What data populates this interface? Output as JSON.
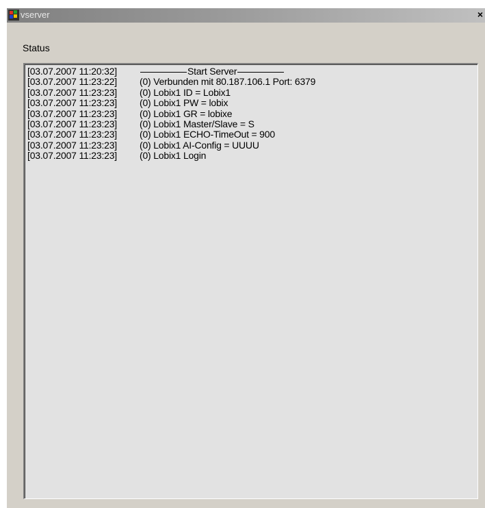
{
  "window": {
    "title": "vserver",
    "close_glyph": "×"
  },
  "status": {
    "label": "Status"
  },
  "log": {
    "start_text": "Start Server",
    "entries": [
      {
        "time": "[03.07.2007 11:20:32]",
        "message": ""
      },
      {
        "time": "[03.07.2007 11:23:22]",
        "message": "(0) Verbunden mit 80.187.106.1 Port: 6379"
      },
      {
        "time": "[03.07.2007 11:23:23]",
        "message": "(0) Lobix1 ID = Lobix1"
      },
      {
        "time": "[03.07.2007 11:23:23]",
        "message": "(0) Lobix1 PW = lobix"
      },
      {
        "time": "[03.07.2007 11:23:23]",
        "message": "(0) Lobix1 GR = lobixe"
      },
      {
        "time": "[03.07.2007 11:23:23]",
        "message": "(0) Lobix1 Master/Slave = S"
      },
      {
        "time": "[03.07.2007 11:23:23]",
        "message": "(0) Lobix1 ECHO-TimeOut = 900"
      },
      {
        "time": "[03.07.2007 11:23:23]",
        "message": "(0) Lobix1 AI-Config = UUUU"
      },
      {
        "time": "[03.07.2007 11:23:23]",
        "message": "(0) Lobix1 Login"
      }
    ]
  },
  "icons": {
    "app": "windows-flag-icon",
    "close": "close-icon"
  }
}
